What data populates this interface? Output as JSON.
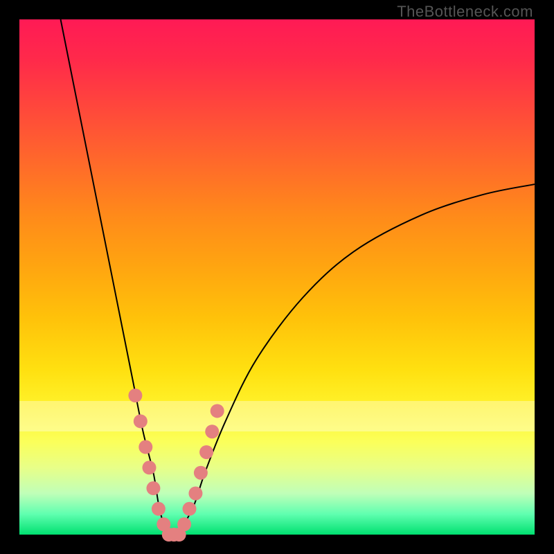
{
  "attribution": "TheBottleneck.com",
  "chart_data": {
    "type": "line",
    "title": "",
    "xlabel": "",
    "ylabel": "",
    "xlim": [
      0,
      100
    ],
    "ylim": [
      0,
      100
    ],
    "series": [
      {
        "name": "bottleneck-curve",
        "x": [
          8,
          12,
          16,
          20,
          22,
          24,
          26,
          27,
          28,
          29,
          30,
          31,
          32,
          34,
          36,
          40,
          46,
          55,
          65,
          78,
          90,
          100
        ],
        "y": [
          100,
          80,
          60,
          40,
          30,
          20,
          12,
          6,
          2,
          0,
          0,
          0,
          2,
          6,
          12,
          22,
          34,
          46,
          55,
          62,
          66,
          68
        ]
      }
    ],
    "markers": {
      "name": "highlighted-points",
      "color": "#e48080",
      "x": [
        22.5,
        23.5,
        24.5,
        25.2,
        26.0,
        27.0,
        28.0,
        29.0,
        30.0,
        31.0,
        32.0,
        33.0,
        34.2,
        35.2,
        36.3,
        37.4,
        38.4
      ],
      "y": [
        27,
        22,
        17,
        13,
        9,
        5,
        2,
        0,
        0,
        0,
        2,
        5,
        8,
        12,
        16,
        20,
        24
      ]
    },
    "bands": [
      {
        "name": "pale-band",
        "y_from": 20,
        "y_to": 26
      }
    ],
    "gradient_stops": [
      {
        "pos": 0,
        "color": "#ff1a55"
      },
      {
        "pos": 50,
        "color": "#ffc20a"
      },
      {
        "pos": 80,
        "color": "#fbff5a"
      },
      {
        "pos": 100,
        "color": "#00e070"
      }
    ]
  }
}
